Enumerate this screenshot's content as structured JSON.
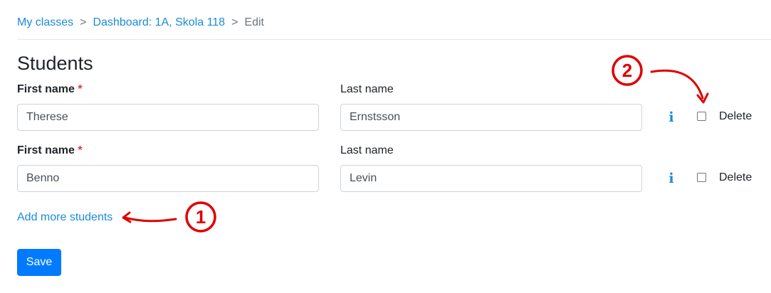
{
  "breadcrumb": {
    "items": [
      "My classes",
      "Dashboard: 1A, Skola 118"
    ],
    "current": "Edit",
    "separator": ">"
  },
  "page_title": "Students",
  "students": [
    {
      "first_name_label": "First name",
      "required_mark": "*",
      "last_name_label": "Last name",
      "first_name": "Therese",
      "last_name": "Ernstsson",
      "info_icon": "i",
      "delete_label": "Delete",
      "delete_checked": false
    },
    {
      "first_name_label": "First name",
      "required_mark": "*",
      "last_name_label": "Last name",
      "first_name": "Benno",
      "last_name": "Levin",
      "info_icon": "i",
      "delete_label": "Delete",
      "delete_checked": false
    }
  ],
  "add_more_label": "Add more students",
  "save_label": "Save",
  "annotations": {
    "marker_1": "1",
    "marker_2": "2",
    "color": "#e00000"
  },
  "colors": {
    "link": "#1a8cd8",
    "primary": "#007bff",
    "required": "#dc3545"
  }
}
